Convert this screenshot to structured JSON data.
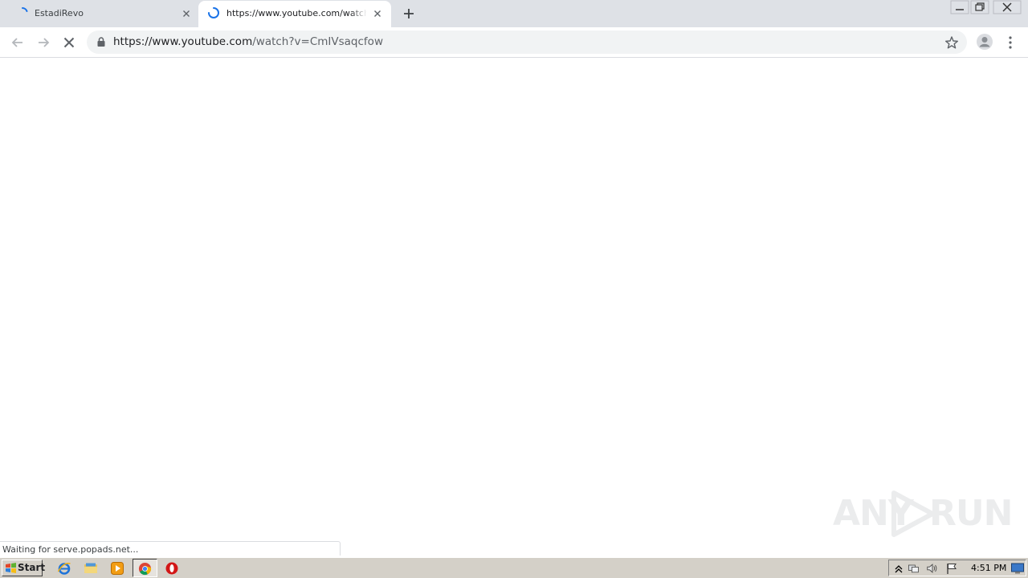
{
  "browser": {
    "tabs": [
      {
        "title": "EstadiRevo",
        "active": false,
        "loading": true
      },
      {
        "title": "https://www.youtube.com/watch?v=CmIVsaqcfow",
        "active": true,
        "loading": true
      }
    ],
    "address_bar": {
      "url_host": "https://www.youtube.com",
      "url_path": "/watch?v=CmIVsaqcfow"
    },
    "status_text": "Waiting for serve.popads.net..."
  },
  "watermark": {
    "left": "ANY",
    "right": "RUN"
  },
  "taskbar": {
    "start_label": "Start",
    "clock": "4:51 PM"
  },
  "colors": {
    "tabstrip": "#dee1e6",
    "spinner": "#1a73e8",
    "taskbar": "#d4d0c8"
  },
  "icons": [
    "tab-spinner-icon",
    "close-icon",
    "plus-icon",
    "minimize-icon",
    "restore-icon",
    "window-close-icon",
    "back-arrow-icon",
    "forward-arrow-icon",
    "stop-icon",
    "lock-icon",
    "star-icon",
    "profile-icon",
    "kebab-menu-icon",
    "windows-flag-icon",
    "ie-icon",
    "explorer-folder-icon",
    "media-player-icon",
    "chrome-icon",
    "opera-icon",
    "tray-arrow-icon",
    "network-icon",
    "volume-icon",
    "action-center-flag-icon",
    "show-desktop-icon"
  ]
}
